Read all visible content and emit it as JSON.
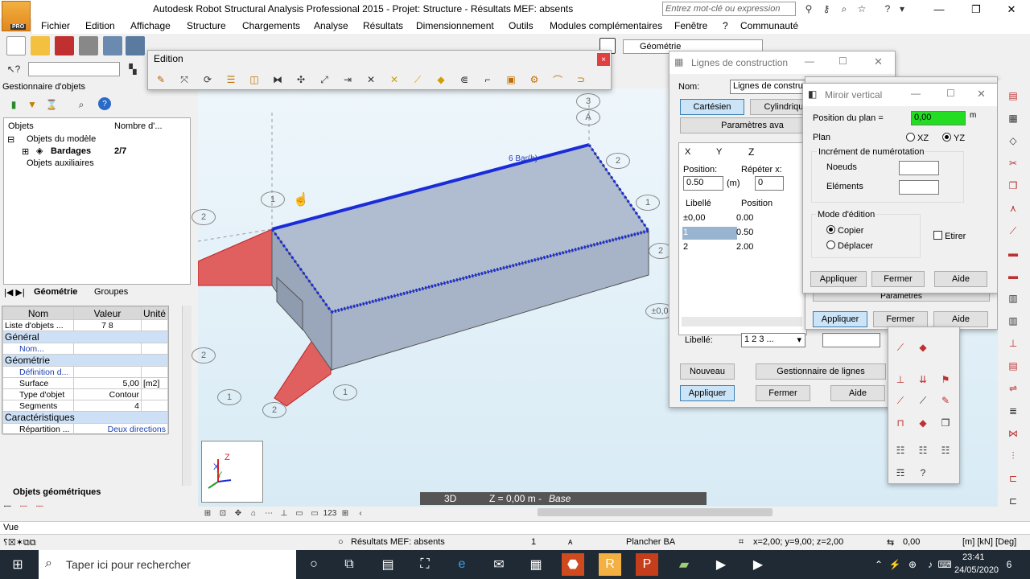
{
  "window": {
    "title": "Autodesk Robot Structural Analysis Professional 2015 - Projet: Structure - Résultats MEF: absents",
    "logo_badge": "PRO",
    "search_placeholder": "Entrez mot-clé ou expression"
  },
  "menu": [
    "Fichier",
    "Edition",
    "Affichage",
    "Structure",
    "Chargements",
    "Analyse",
    "Résultats",
    "Dimensionnement",
    "Outils",
    "Modules complémentaires",
    "Fenêtre",
    "?",
    "Communauté"
  ],
  "toolbar": {
    "geometry_combo": "Géométrie"
  },
  "edition_toolbar": {
    "title": "Edition",
    "close": "×"
  },
  "object_manager": {
    "title": "Gestionnaire d'objets",
    "col_objects": "Objets",
    "col_count": "Nombre d'...",
    "tree": [
      {
        "label": "Objets du modèle"
      },
      {
        "label": "Bardages",
        "count": "2/7"
      },
      {
        "label": "Objets auxiliaires"
      }
    ],
    "tabs": [
      "Géométrie",
      "Groupes"
    ],
    "bottom_tab": "Objets géométriques"
  },
  "properties": {
    "headers": [
      "Nom",
      "Valeur",
      "Unité"
    ],
    "list_label": "Liste d'objets ...",
    "list_value": "7 8",
    "sections": {
      "general": "Général",
      "name_label": "Nom...",
      "geometry": "Géométrie",
      "def_label": "Définition d...",
      "surface_label": "Surface",
      "surface_value": "5,00",
      "surface_unit": "[m2]",
      "type_label": "Type d'objet",
      "type_value": "Contour",
      "segments_label": "Segments",
      "segments_value": "4",
      "characteristics": "Caractéristiques",
      "repartition_label": "Répartition ...",
      "repartition_value": "Deux directions"
    }
  },
  "viewport": {
    "axis_labels": [
      "1",
      "2",
      "3",
      "A",
      "1",
      "2",
      "1",
      "2",
      "1",
      "2",
      "±0,0",
      "2"
    ],
    "bay_label": "6 Bar(b)",
    "view_mode": "3D",
    "level_label": "Z = 0,00 m - ",
    "level_name": "Base",
    "view_label": "Vue",
    "axis_x": "X",
    "axis_y": "Y",
    "axis_z": "Z"
  },
  "lignes_dialog": {
    "title": "Lignes de construction",
    "name_label": "Nom:",
    "name_value": "Lignes de construct",
    "tab_cartesian": "Cartésien",
    "tab_cylindrical": "Cylindrique",
    "params_btn": "Paramètres ava",
    "axis_tabs": [
      "X",
      "Y",
      "Z"
    ],
    "position_label": "Position:",
    "position_value": "0.50",
    "unit": "(m)",
    "repeat_label": "Répéter x:",
    "repeat_value": "0",
    "list_headers": [
      "Libellé",
      "Position"
    ],
    "rows": [
      {
        "label": "±0,00",
        "pos": "0.00"
      },
      {
        "label": "1",
        "pos": "0.50"
      },
      {
        "label": "2",
        "pos": "2.00"
      }
    ],
    "libelle_label": "Libellé:",
    "libelle_value": "1 2 3 ...",
    "btn_new": "Nouveau",
    "btn_manager": "Gestionnaire de lignes",
    "btn_apply": "Appliquer",
    "btn_close": "Fermer",
    "btn_help": "Aide"
  },
  "behind_dialog": {
    "params": "Paramètres",
    "btn_apply": "Appliquer",
    "btn_close": "Fermer",
    "btn_help": "Aide"
  },
  "miroir_dialog": {
    "title": "Miroir vertical",
    "plane_pos_label": "Position du plan =",
    "plane_pos_value": "0,00",
    "unit": "m",
    "plan_label": "Plan",
    "opt_xz": "XZ",
    "opt_yz": "YZ",
    "numbering_title": "Incrément de numérotation",
    "nodes_label": "Noeuds",
    "elements_label": "Eléments",
    "edit_mode_title": "Mode d'édition",
    "opt_copy": "Copier",
    "opt_move": "Déplacer",
    "stretch_label": "Etirer",
    "btn_apply": "Appliquer",
    "btn_close": "Fermer",
    "btn_help": "Aide"
  },
  "status": {
    "results": "Résultats MEF: absents",
    "number": "1",
    "section": "Plancher BA",
    "coords": "x=2,00; y=9,00; z=2,00",
    "offset": "0,00",
    "units": "[m] [kN] [Deg]"
  },
  "taskbar": {
    "search_placeholder": "Taper ici pour rechercher",
    "time": "23:41",
    "date": "24/05/2020",
    "notif_count": "6"
  }
}
